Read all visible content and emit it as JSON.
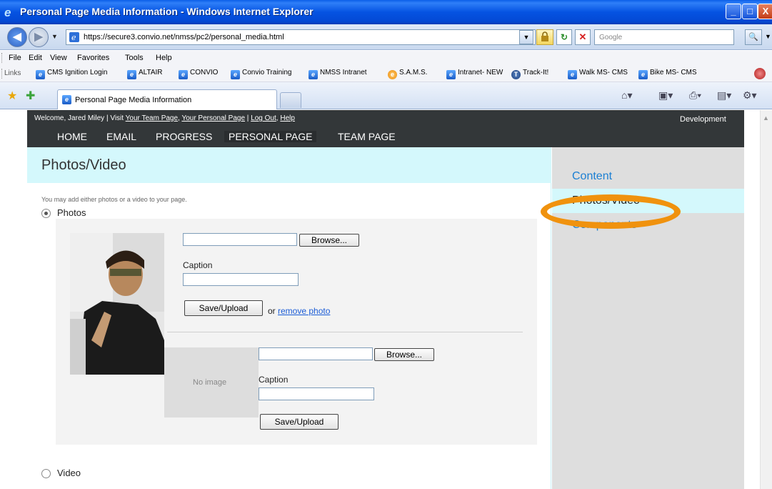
{
  "window": {
    "title": "Personal Page Media Information - Windows Internet Explorer"
  },
  "address": {
    "url": "https://secure3.convio.net/nmss/pc2/personal_media.html",
    "search_placeholder": "Google"
  },
  "menu": [
    "File",
    "Edit",
    "View",
    "Favorites",
    "Tools",
    "Help"
  ],
  "links_bar": {
    "label": "Links",
    "items": [
      "CMS Ignition Login",
      "ALTAIR",
      "CONVIO",
      "Convio Training",
      "NMSS Intranet",
      "S.A.M.S.",
      "Intranet- NEW",
      "Track-It!",
      "Walk MS- CMS",
      "Bike MS- CMS"
    ]
  },
  "tab": {
    "label": "Personal Page Media Information"
  },
  "site": {
    "welcome_prefix": "Welcome, Jared Miley | Visit",
    "welcome_links": [
      "Your Team Page",
      "Your Personal Page",
      "Log Out",
      "Help"
    ],
    "environment": "Development",
    "nav": [
      "HOME",
      "EMAIL",
      "PROGRESS",
      "PERSONAL PAGE",
      "TEAM PAGE"
    ]
  },
  "main": {
    "heading": "Photos/Video",
    "intro": "You may add either photos or a video to your page.",
    "photos_label": "Photos",
    "video_label": "Video",
    "browse_label": "Browse...",
    "caption_label": "Caption",
    "save_label": "Save/Upload",
    "or_text": "or",
    "remove_label": "remove photo",
    "no_image": "No image"
  },
  "sidebar": {
    "items": [
      "Content",
      "Photos/Video",
      "Components"
    ]
  },
  "colors": {
    "highlight": "#f0920e",
    "link": "#1b7fd3",
    "header_bg": "#333739",
    "light_cyan": "#d4f8fc"
  }
}
